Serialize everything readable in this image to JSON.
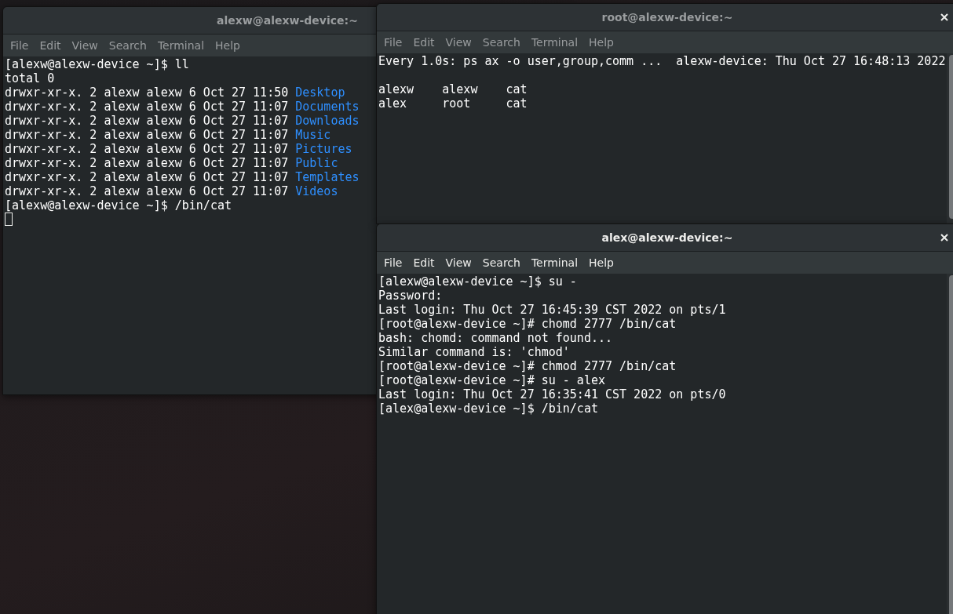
{
  "windows": [
    {
      "title": "alexw@alexw-device:~",
      "focused": false,
      "cursor": true,
      "menu": [
        "File",
        "Edit",
        "View",
        "Search",
        "Terminal",
        "Help"
      ],
      "lines": [
        {
          "text": "[alexw@alexw-device ~]$ ll"
        },
        {
          "text": "total 0"
        },
        {
          "text": "drwxr-xr-x. 2 alexw alexw 6 Oct 27 11:50",
          "dir": "Desktop"
        },
        {
          "text": "drwxr-xr-x. 2 alexw alexw 6 Oct 27 11:07",
          "dir": "Documents"
        },
        {
          "text": "drwxr-xr-x. 2 alexw alexw 6 Oct 27 11:07",
          "dir": "Downloads"
        },
        {
          "text": "drwxr-xr-x. 2 alexw alexw 6 Oct 27 11:07",
          "dir": "Music"
        },
        {
          "text": "drwxr-xr-x. 2 alexw alexw 6 Oct 27 11:07",
          "dir": "Pictures"
        },
        {
          "text": "drwxr-xr-x. 2 alexw alexw 6 Oct 27 11:07",
          "dir": "Public"
        },
        {
          "text": "drwxr-xr-x. 2 alexw alexw 6 Oct 27 11:07",
          "dir": "Templates"
        },
        {
          "text": "drwxr-xr-x. 2 alexw alexw 6 Oct 27 11:07",
          "dir": "Videos"
        },
        {
          "text": "[alexw@alexw-device ~]$ /bin/cat"
        }
      ]
    },
    {
      "title": "root@alexw-device:~",
      "focused": false,
      "closable": true,
      "scrollbar": true,
      "cursor": false,
      "menu": [
        "File",
        "Edit",
        "View",
        "Search",
        "Terminal",
        "Help"
      ],
      "header": "Every 1.0s: ps ax -o user,group,comm ...  alexw-device: Thu Oct 27 16:48:13 2022",
      "lines": [
        {
          "text": "alexw    alexw    cat"
        },
        {
          "text": "alex     root     cat"
        }
      ]
    },
    {
      "title": "alex@alexw-device:~",
      "focused": true,
      "closable": true,
      "scrollbar": true,
      "cursor": false,
      "menu": [
        "File",
        "Edit",
        "View",
        "Search",
        "Terminal",
        "Help"
      ],
      "lines": [
        {
          "text": "[alexw@alexw-device ~]$ su -"
        },
        {
          "text": "Password:"
        },
        {
          "text": "Last login: Thu Oct 27 16:45:39 CST 2022 on pts/1"
        },
        {
          "text": "[root@alexw-device ~]# chomd 2777 /bin/cat"
        },
        {
          "text": "bash: chomd: command not found..."
        },
        {
          "text": "Similar command is: 'chmod'"
        },
        {
          "text": "[root@alexw-device ~]# chmod 2777 /bin/cat"
        },
        {
          "text": "[root@alexw-device ~]# su - alex"
        },
        {
          "text": "Last login: Thu Oct 27 16:35:41 CST 2022 on pts/0"
        },
        {
          "text": "[alex@alexw-device ~]$ /bin/cat"
        }
      ]
    }
  ]
}
